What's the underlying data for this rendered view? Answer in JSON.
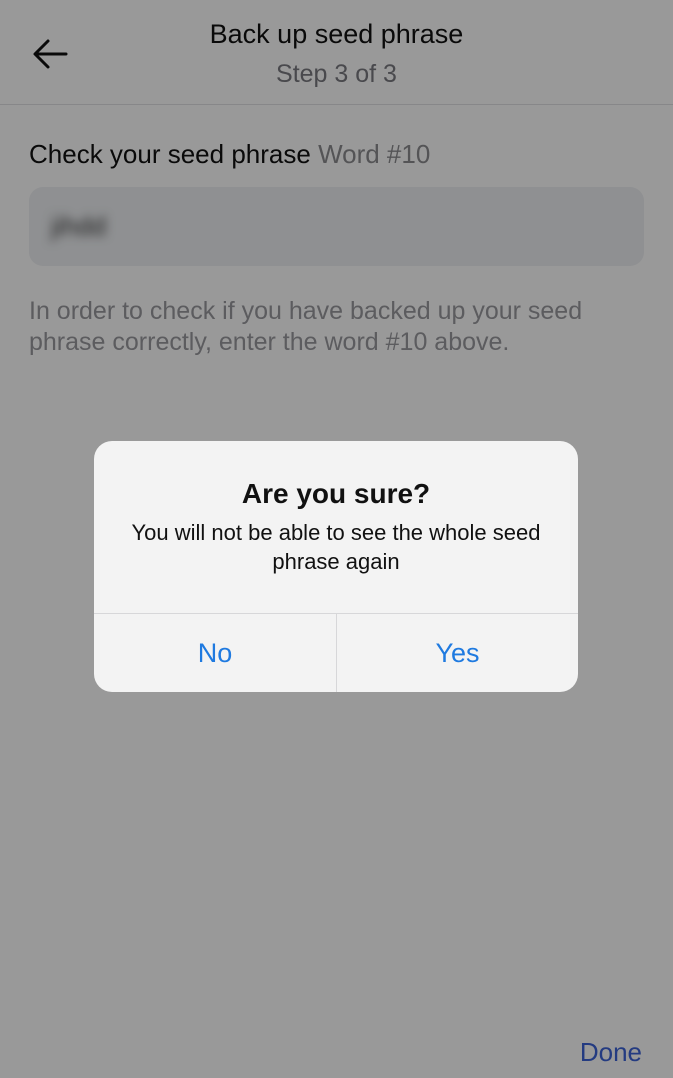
{
  "header": {
    "title": "Back up seed phrase",
    "step": "Step 3 of 3"
  },
  "check": {
    "label": "Check your seed phrase",
    "word_label": "Word #10",
    "input_value": "jihdd",
    "hint": "In order to check if you have backed up your seed phrase correctly, enter the word #10 above."
  },
  "footer": {
    "done_label": "Done"
  },
  "dialog": {
    "title": "Are you sure?",
    "message": "You will not be able to see the whole seed phrase again",
    "no_label": "No",
    "yes_label": "Yes"
  },
  "colors": {
    "accent_link": "#1f7ae0",
    "done": "#3c63d8"
  }
}
